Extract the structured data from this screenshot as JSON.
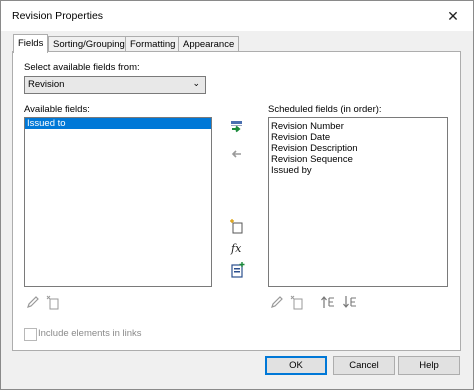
{
  "window": {
    "title": "Revision Properties",
    "close_glyph": "✕"
  },
  "tabs": [
    {
      "label": "Fields",
      "active": true
    },
    {
      "label": "Sorting/Grouping",
      "active": false
    },
    {
      "label": "Formatting",
      "active": false
    },
    {
      "label": "Appearance",
      "active": false
    }
  ],
  "source": {
    "label": "Select available fields from:",
    "selected": "Revision",
    "chevron_glyph": "⌄"
  },
  "available": {
    "label": "Available fields:",
    "items": [
      "Issued to"
    ],
    "selected_index": 0
  },
  "scheduled": {
    "label": "Scheduled fields (in order):",
    "items": [
      "Revision Number",
      "Revision Date",
      "Revision Description",
      "Revision Sequence",
      "Issued by"
    ]
  },
  "icons": {
    "add_parameter": "add-parameter-icon",
    "remove_parameter": "remove-parameter-icon",
    "new_parameter": "new-parameter-icon",
    "calculated_value": "calculated-value-icon",
    "combine_parameters": "combine-parameters-icon",
    "edit_parameter": "edit-parameter-icon",
    "delete_parameter": "delete-parameter-icon",
    "move_up": "move-up-icon",
    "move_down": "move-down-icon",
    "fx_glyph": "fx"
  },
  "include_links": {
    "label": "Include elements in links",
    "checked": false,
    "enabled": false
  },
  "buttons": {
    "ok": "OK",
    "cancel": "Cancel",
    "help": "Help"
  },
  "colors": {
    "selection": "#0078d7",
    "add_arrow": "#1b8a3a",
    "disabled_icon": "#9a9a9a"
  }
}
